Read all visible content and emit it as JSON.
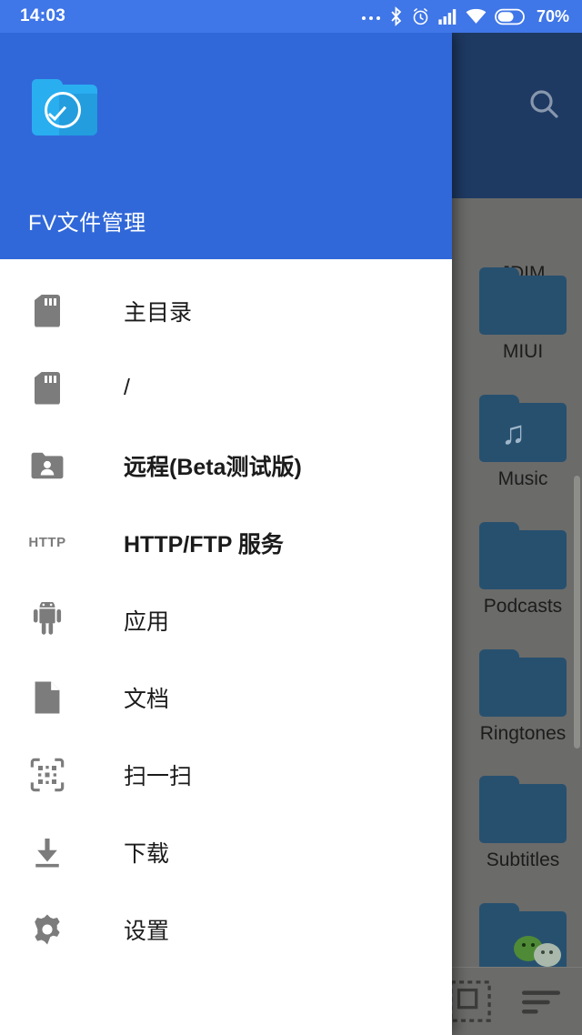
{
  "status_bar": {
    "time": "14:03",
    "battery_text": "70%",
    "icons": [
      "more-dots-icon",
      "bluetooth-icon",
      "alarm-icon",
      "signal-icon",
      "wifi-icon",
      "battery-icon"
    ]
  },
  "colors": {
    "status_bar_blue": "#3f76e8",
    "drawer_header_blue": "#3068d9",
    "app_icon_blue": "#29aef0",
    "scrim_gray": "#6b6b69",
    "bg_toolbar_blue": "#1e3a63",
    "folder_blue": "#27506f",
    "text_dark": "#1b1b1b"
  },
  "drawer": {
    "app_name": "FV文件管理",
    "app_icon": "folder-check-icon",
    "items": [
      {
        "label": "主目录",
        "icon": "sd-card-icon",
        "bold": false
      },
      {
        "label": "/",
        "icon": "sd-card-icon",
        "bold": false
      },
      {
        "label": "远程(Beta测试版)",
        "icon": "folder-user-icon",
        "bold": true
      },
      {
        "label": "HTTP/FTP 服务",
        "icon": "http-icon",
        "bold": true,
        "glyph": "HTTP"
      },
      {
        "label": "应用",
        "icon": "android-icon",
        "bold": false
      },
      {
        "label": "文档",
        "icon": "document-icon",
        "bold": false
      },
      {
        "label": "扫一扫",
        "icon": "qr-scan-icon",
        "bold": false
      },
      {
        "label": "下载",
        "icon": "download-icon",
        "bold": false
      },
      {
        "label": "设置",
        "icon": "gear-icon",
        "bold": false
      }
    ]
  },
  "background_app": {
    "search_icon": "search-icon",
    "files": [
      {
        "name": "JDIM",
        "icon": "folder-icon"
      },
      {
        "name": "MIUI",
        "icon": "folder-icon"
      },
      {
        "name": "Music",
        "icon": "folder-music-icon"
      },
      {
        "name": "Podcasts",
        "icon": "folder-icon"
      },
      {
        "name": "Ringtones",
        "icon": "folder-icon"
      },
      {
        "name": "Subtitles",
        "icon": "folder-icon"
      },
      {
        "name": "",
        "icon": "folder-wechat-icon"
      }
    ],
    "bottom_bar": {
      "select_label": "select-mode",
      "sort_label": "sort-mode"
    }
  }
}
